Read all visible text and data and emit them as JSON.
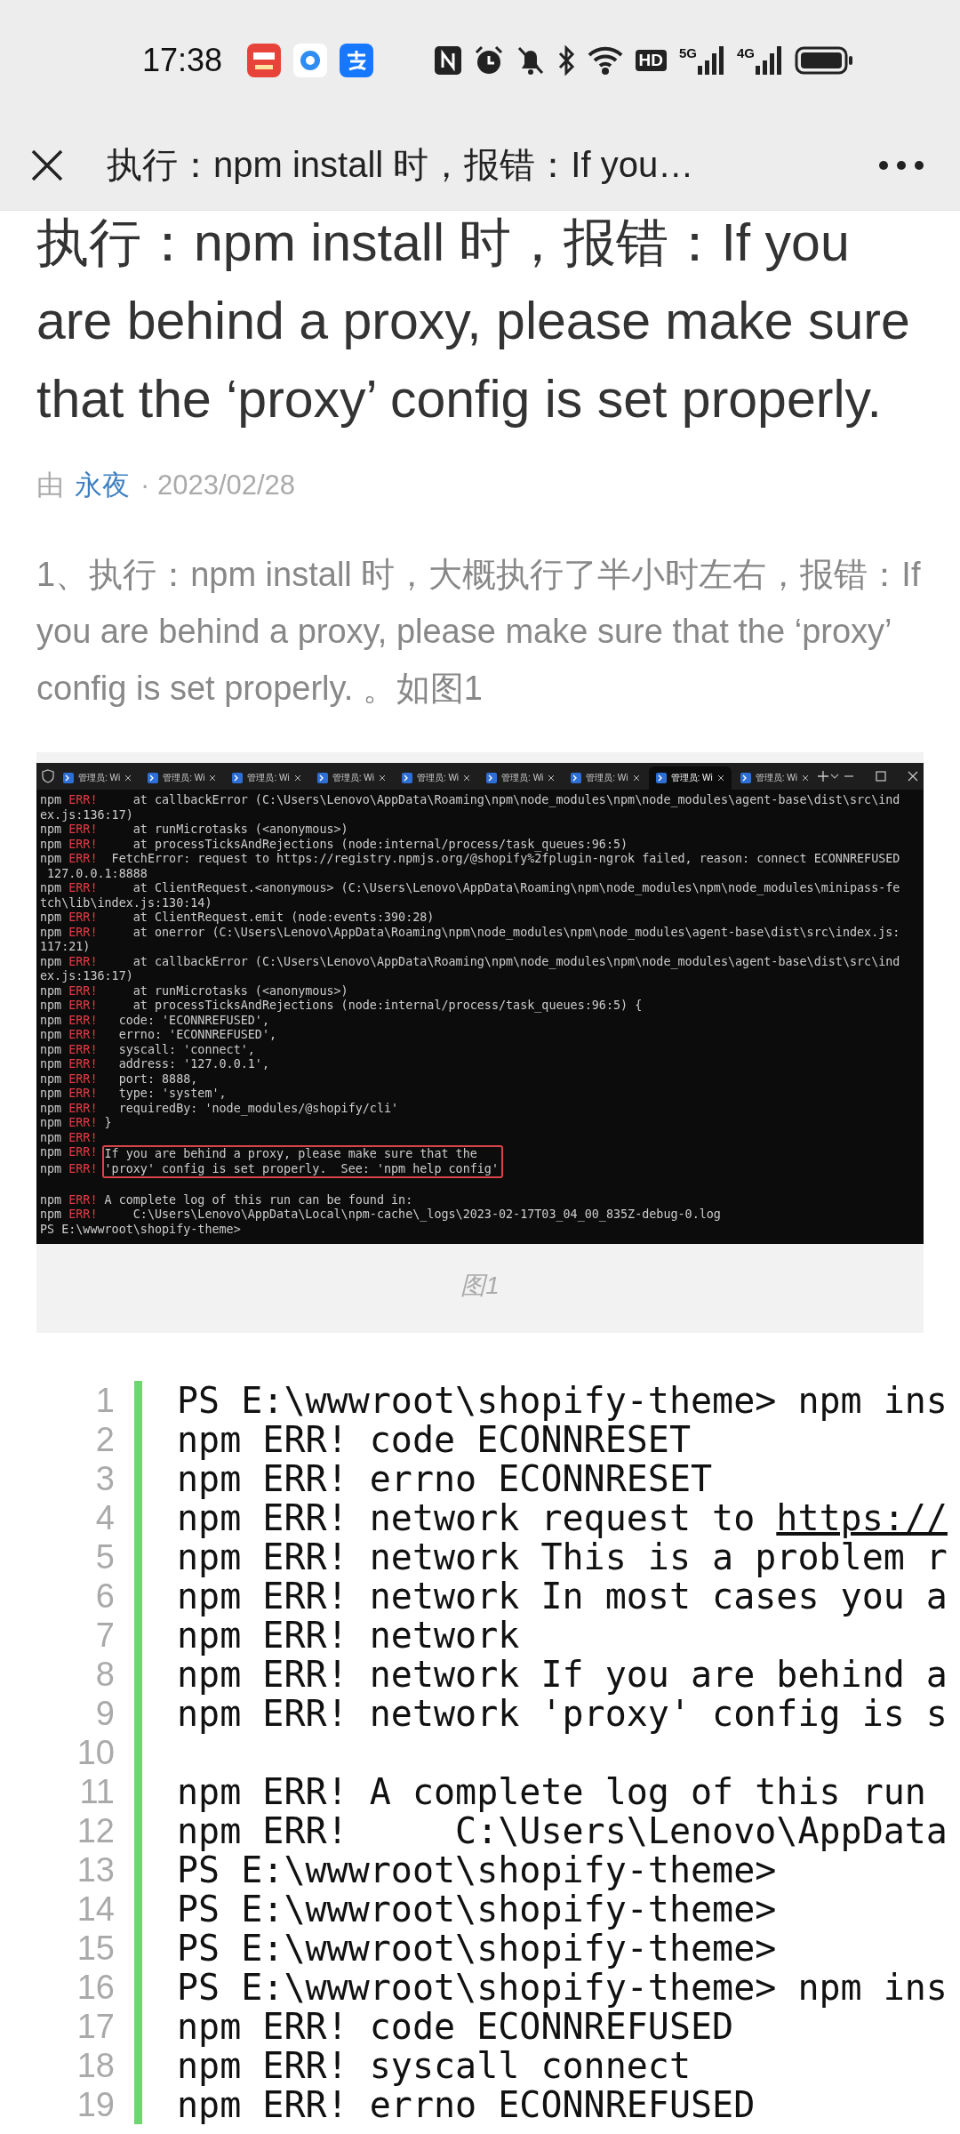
{
  "status_bar": {
    "time": "17:38",
    "hd_label": "HD",
    "signal_labels": [
      "5G",
      "4G"
    ]
  },
  "nav": {
    "title": "执行：npm install 时，报错：If you…"
  },
  "article": {
    "title": "执行：npm install 时，报错：If you are behind a proxy, please make sure that the ‘proxy’ config is set properly.",
    "meta": {
      "by": "由",
      "author": "永夜",
      "date": "· 2023/02/28"
    },
    "paragraph": "1、执行：npm install 时，大概执行了半小时左右，报错：If you are behind a proxy, please make sure that the ‘proxy’ config is set properly. 。如图1",
    "figure": {
      "terminal": {
        "tabs": [
          {
            "label": "管理员: Wi",
            "selected": false
          },
          {
            "label": "管理员: Wi",
            "selected": false
          },
          {
            "label": "管理员: Wi",
            "selected": false
          },
          {
            "label": "管理员: Wi",
            "selected": false
          },
          {
            "label": "管理员: Wi",
            "selected": false
          },
          {
            "label": "管理员: Wi",
            "selected": false
          },
          {
            "label": "管理员: Wi",
            "selected": false
          },
          {
            "label": "管理员: Wi",
            "selected": true
          },
          {
            "label": "管理员: Wi",
            "selected": false
          }
        ],
        "lines": [
          {
            "kind": "error",
            "npm": "npm",
            "err": "ERR!",
            "text": "    at callbackError (C:\\Users\\Lenovo\\AppData\\Roaming\\npm\\node_modules\\npm\\node_modules\\agent-base\\dist\\src\\ind"
          },
          {
            "kind": "plain",
            "text": "ex.js:136:17)"
          },
          {
            "kind": "error",
            "npm": "npm",
            "err": "ERR!",
            "text": "    at runMicrotasks (<anonymous>)"
          },
          {
            "kind": "error",
            "npm": "npm",
            "err": "ERR!",
            "text": "    at processTicksAndRejections (node:internal/process/task_queues:96:5)"
          },
          {
            "kind": "error",
            "npm": "npm",
            "err": "ERR!",
            "text": " FetchError: request to https://registry.npmjs.org/@shopify%2fplugin-ngrok failed, reason: connect ECONNREFUSED"
          },
          {
            "kind": "plain",
            "text": " 127.0.0.1:8888"
          },
          {
            "kind": "error",
            "npm": "npm",
            "err": "ERR!",
            "text": "    at ClientRequest.<anonymous> (C:\\Users\\Lenovo\\AppData\\Roaming\\npm\\node_modules\\npm\\node_modules\\minipass-fe"
          },
          {
            "kind": "plain",
            "text": "tch\\lib\\index.js:130:14)"
          },
          {
            "kind": "error",
            "npm": "npm",
            "err": "ERR!",
            "text": "    at ClientRequest.emit (node:events:390:28)"
          },
          {
            "kind": "error",
            "npm": "npm",
            "err": "ERR!",
            "text": "    at onerror (C:\\Users\\Lenovo\\AppData\\Roaming\\npm\\node_modules\\npm\\node_modules\\agent-base\\dist\\src\\index.js:"
          },
          {
            "kind": "plain",
            "text": "117:21)"
          },
          {
            "kind": "error",
            "npm": "npm",
            "err": "ERR!",
            "text": "    at callbackError (C:\\Users\\Lenovo\\AppData\\Roaming\\npm\\node_modules\\npm\\node_modules\\agent-base\\dist\\src\\ind"
          },
          {
            "kind": "plain",
            "text": "ex.js:136:17)"
          },
          {
            "kind": "error",
            "npm": "npm",
            "err": "ERR!",
            "text": "    at runMicrotasks (<anonymous>)"
          },
          {
            "kind": "error",
            "npm": "npm",
            "err": "ERR!",
            "text": "    at processTicksAndRejections (node:internal/process/task_queues:96:5) {"
          },
          {
            "kind": "error",
            "npm": "npm",
            "err": "ERR!",
            "text": "  code: 'ECONNREFUSED',"
          },
          {
            "kind": "error",
            "npm": "npm",
            "err": "ERR!",
            "text": "  errno: 'ECONNREFUSED',"
          },
          {
            "kind": "error",
            "npm": "npm",
            "err": "ERR!",
            "text": "  syscall: 'connect',"
          },
          {
            "kind": "error",
            "npm": "npm",
            "err": "ERR!",
            "text": "  address: '127.0.0.1',"
          },
          {
            "kind": "error",
            "npm": "npm",
            "err": "ERR!",
            "text": "  port: 8888,"
          },
          {
            "kind": "error",
            "npm": "npm",
            "err": "ERR!",
            "text": "  type: 'system',"
          },
          {
            "kind": "error",
            "npm": "npm",
            "err": "ERR!",
            "text": "  requiredBy: 'node_modules/@shopify/cli'"
          },
          {
            "kind": "error",
            "npm": "npm",
            "err": "ERR!",
            "text": "}"
          },
          {
            "kind": "error",
            "npm": "npm",
            "err": "ERR!"
          },
          {
            "kind": "highlight",
            "npm": "npm",
            "err": "ERR!",
            "text": "If you are behind a proxy, please make sure that the"
          },
          {
            "kind": "highlight",
            "npm": "npm",
            "err": "ERR!",
            "text": "'proxy' config is set properly.  See: 'npm help config'"
          },
          {
            "kind": "blank"
          },
          {
            "kind": "error",
            "npm": "npm",
            "err": "ERR!",
            "text": "A complete log of this run can be found in:"
          },
          {
            "kind": "error",
            "npm": "npm",
            "err": "ERR!",
            "text": "    C:\\Users\\Lenovo\\AppData\\Local\\npm-cache\\_logs\\2023-02-17T03_04_00_835Z-debug-0.log"
          },
          {
            "kind": "plain",
            "text": "PS E:\\wwwroot\\shopify-theme>"
          }
        ]
      },
      "caption": "图1"
    },
    "code": {
      "lines": [
        {
          "number": "1",
          "text": "PS E:\\wwwroot\\shopify-theme> npm ins"
        },
        {
          "number": "2",
          "text": "npm ERR! code ECONNRESET"
        },
        {
          "number": "3",
          "text": "npm ERR! errno ECONNRESET"
        },
        {
          "number": "4",
          "text": "npm ERR! network request to ",
          "link": "https://"
        },
        {
          "number": "5",
          "text": "npm ERR! network This is a problem r"
        },
        {
          "number": "6",
          "text": "npm ERR! network In most cases you a"
        },
        {
          "number": "7",
          "text": "npm ERR! network"
        },
        {
          "number": "8",
          "text": "npm ERR! network If you are behind a"
        },
        {
          "number": "9",
          "text": "npm ERR! network 'proxy' config is s"
        },
        {
          "number": "10"
        },
        {
          "number": "11",
          "text": "npm ERR! A complete log of this run"
        },
        {
          "number": "12",
          "text": "npm ERR!     C:\\Users\\Lenovo\\AppData"
        },
        {
          "number": "13",
          "text": "PS E:\\wwwroot\\shopify-theme>"
        },
        {
          "number": "14",
          "text": "PS E:\\wwwroot\\shopify-theme>"
        },
        {
          "number": "15",
          "text": "PS E:\\wwwroot\\shopify-theme>"
        },
        {
          "number": "16",
          "text": "PS E:\\wwwroot\\shopify-theme> npm ins"
        },
        {
          "number": "17",
          "text": "npm ERR! code ECONNREFUSED"
        },
        {
          "number": "18",
          "text": "npm ERR! syscall connect"
        },
        {
          "number": "19",
          "text": "npm ERR! errno ECONNREFUSED"
        }
      ]
    }
  }
}
